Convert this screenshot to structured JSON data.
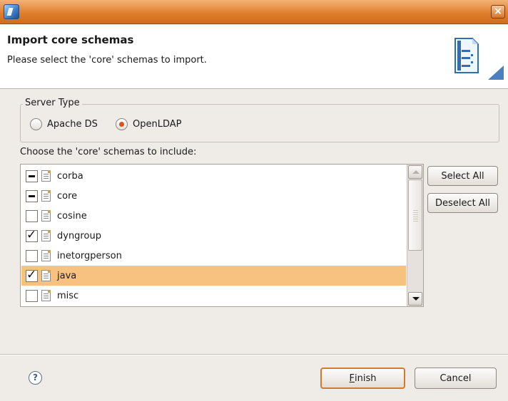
{
  "titlebar": {
    "icon": "app-window-icon",
    "close_label": "×"
  },
  "banner": {
    "title": "Import core schemas",
    "description": "Please select the 'core' schemas to import.",
    "image": "wizard-document-icon"
  },
  "server_type": {
    "legend": "Server Type",
    "options": [
      {
        "label": "Apache DS",
        "selected": false
      },
      {
        "label": "OpenLDAP",
        "selected": true
      }
    ]
  },
  "schemas": {
    "label": "Choose the 'core' schemas to include:",
    "items": [
      {
        "name": "corba",
        "state": "indeterminate",
        "selected": false
      },
      {
        "name": "core",
        "state": "indeterminate",
        "selected": false
      },
      {
        "name": "cosine",
        "state": "unchecked",
        "selected": false
      },
      {
        "name": "dyngroup",
        "state": "checked",
        "selected": false
      },
      {
        "name": "inetorgperson",
        "state": "unchecked",
        "selected": false
      },
      {
        "name": "java",
        "state": "checked",
        "selected": true
      },
      {
        "name": "misc",
        "state": "unchecked",
        "selected": false
      }
    ]
  },
  "actions": {
    "select_all": "Select All",
    "deselect_all": "Deselect All",
    "finish_mnemonic": "F",
    "finish_rest": "inish",
    "cancel": "Cancel",
    "help": "?"
  },
  "colors": {
    "titlebar": "#e07f2c",
    "selection": "#f7c27f",
    "radio_dot": "#d3561e",
    "default_button_border": "#d07a2b"
  }
}
